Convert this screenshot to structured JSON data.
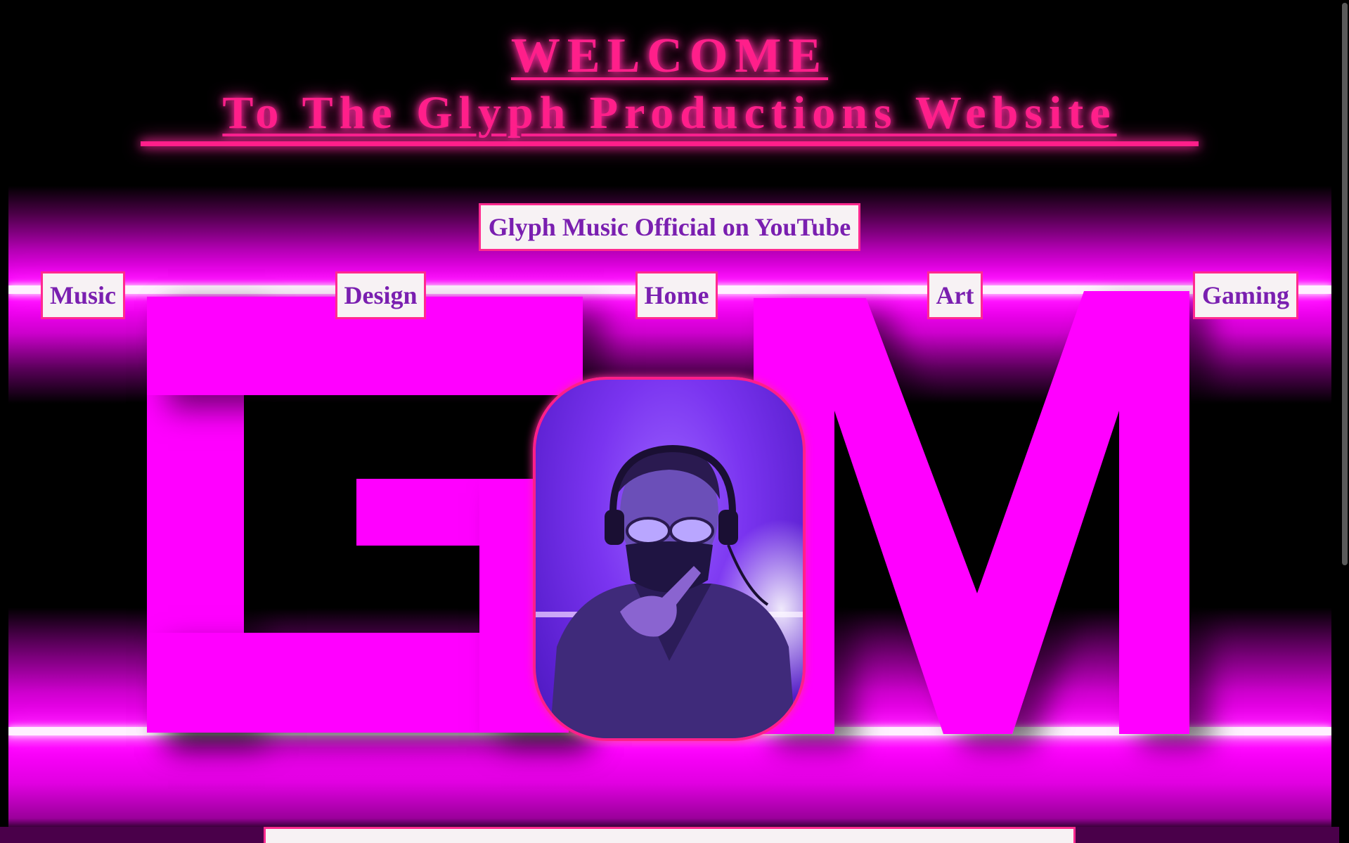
{
  "header": {
    "title": "WELCOME",
    "subtitle": "To The Glyph Productions Website"
  },
  "nav": {
    "youtube_label": "Glyph Music Official on YouTube",
    "items": [
      {
        "label": "Music"
      },
      {
        "label": "Design"
      },
      {
        "label": "Home"
      },
      {
        "label": "Art"
      },
      {
        "label": "Gaming"
      }
    ]
  },
  "colors": {
    "neon_pink": "#ff1f8a",
    "magenta": "#ff00ff",
    "button_text": "#7a1fb0",
    "button_bg": "#f7f2f4",
    "background": "#000000",
    "portrait_purple": "#7a34f0"
  },
  "icons": {
    "banner_logo": "gm-logo",
    "portrait": "profile-photo"
  }
}
